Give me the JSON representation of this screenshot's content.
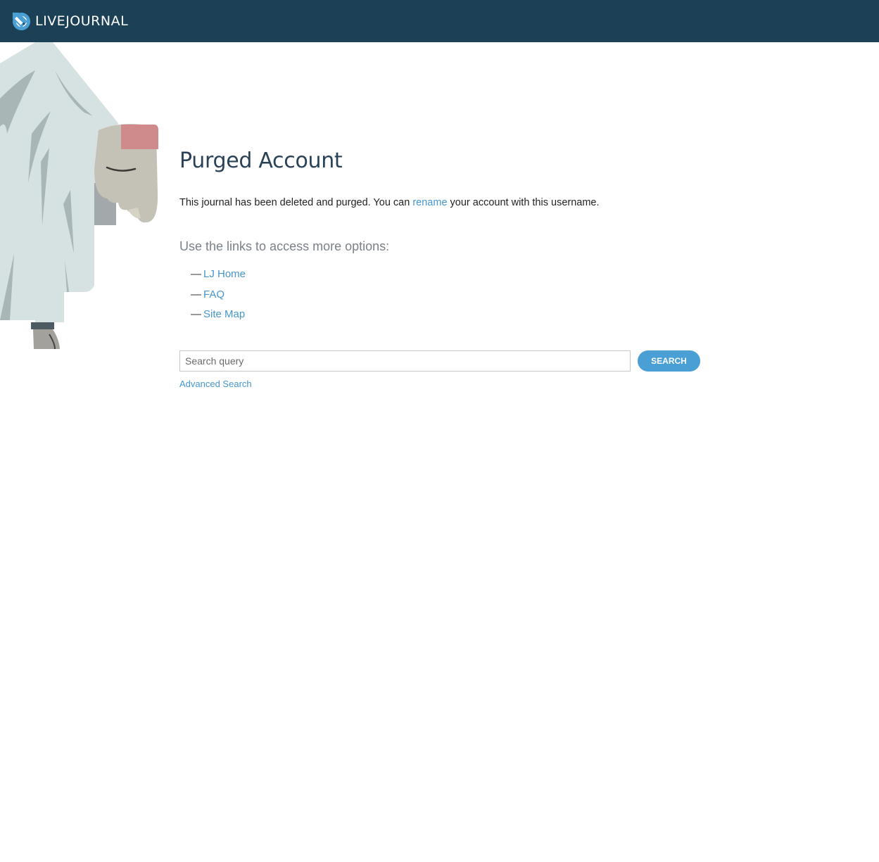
{
  "header": {
    "logo_text": "LIVEJOURNAL",
    "logo_icon": "livejournal-pencil-icon",
    "background_color": "#1c4157"
  },
  "main": {
    "title": "Purged Account",
    "message_before": "This journal has been deleted and purged. You can ",
    "rename_link": "rename",
    "message_after": " your account with this username.",
    "options_heading": "Use the links to access more options:",
    "links": [
      {
        "dash": "—",
        "label": "LJ Home"
      },
      {
        "dash": "—",
        "label": "FAQ"
      },
      {
        "dash": "—",
        "label": "Site Map"
      }
    ]
  },
  "search": {
    "placeholder": "Search query",
    "value": "",
    "button_label": "SEARCH",
    "advanced_link": "Advanced Search"
  },
  "colors": {
    "link": "#4696cd",
    "button": "#4a9fd5",
    "title": "#2a4257"
  },
  "illustration": "ghost-icon"
}
